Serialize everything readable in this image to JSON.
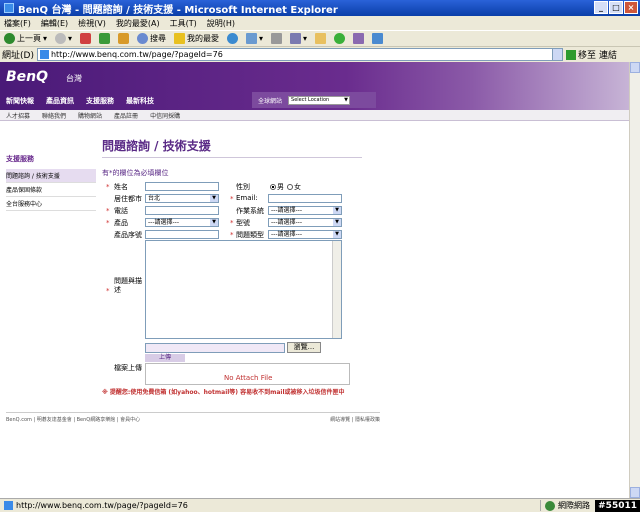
{
  "window": {
    "title": "BenQ 台灣 - 問題諮詢 / 技術支援 - Microsoft Internet Explorer"
  },
  "menu": [
    "檔案(F)",
    "編輯(E)",
    "檢視(V)",
    "我的最愛(A)",
    "工具(T)",
    "說明(H)"
  ],
  "toolbar": {
    "back": "上一頁",
    "search": "搜尋",
    "favorites": "我的最愛"
  },
  "address": {
    "label": "網址(D)",
    "url": "http://www.benq.com.tw/page/?pageId=76",
    "go": "移至",
    "links": "連結"
  },
  "site": {
    "brand": "BenQ",
    "region": "台灣",
    "topnav": [
      "新聞快報",
      "產品資訊",
      "支援服務",
      "最新科技"
    ],
    "global_label": "全球網站",
    "location_select": "Select Location",
    "subnav": [
      "人才招募",
      "聯絡我們",
      "購物網站",
      "產品註冊",
      "中信同採購"
    ]
  },
  "sidebar": {
    "title": "支援服務",
    "items": [
      "問題諮詢 / 技術支援",
      "產品保固條款",
      "全台服務中心"
    ]
  },
  "form": {
    "title": "問題諮詢 / 技術支援",
    "required_note": "有*的欄位為必填欄位",
    "name_label": "姓名",
    "gender_label": "性別",
    "gender_male": "男",
    "gender_female": "女",
    "city_label": "居住都市",
    "city_value": "台北",
    "email_label": "Email:",
    "phone_label": "電話",
    "os_label": "作業系統",
    "os_value": "---請選擇---",
    "product_label": "產品",
    "product_value": "---請選擇---",
    "model_label": "型號",
    "model_value": "---請選擇---",
    "serial_label": "產品序號",
    "issue_type_label": "問題類型",
    "issue_type_value": "---請選擇---",
    "desc_label": "問題與描述",
    "browse_label": "瀏覽...",
    "upload_label": "上傳",
    "file_label": "檔案上傳",
    "no_attach": "No Attach File",
    "warning": "※ 提醒您:使用免費信箱 (如yahoo、hotmail等) 容易收不到mail或被移入垃圾信件匣中"
  },
  "footer": {
    "left": "BenQ.com | 明碁友達基金會 | BenQ網路享樂館 | 會員中心",
    "right": "網站導覽 | 隱私權政策"
  },
  "status": {
    "url": "http://www.benq.com.tw/page/?pageId=76",
    "zone": "網際網路",
    "tag": "#55011"
  }
}
